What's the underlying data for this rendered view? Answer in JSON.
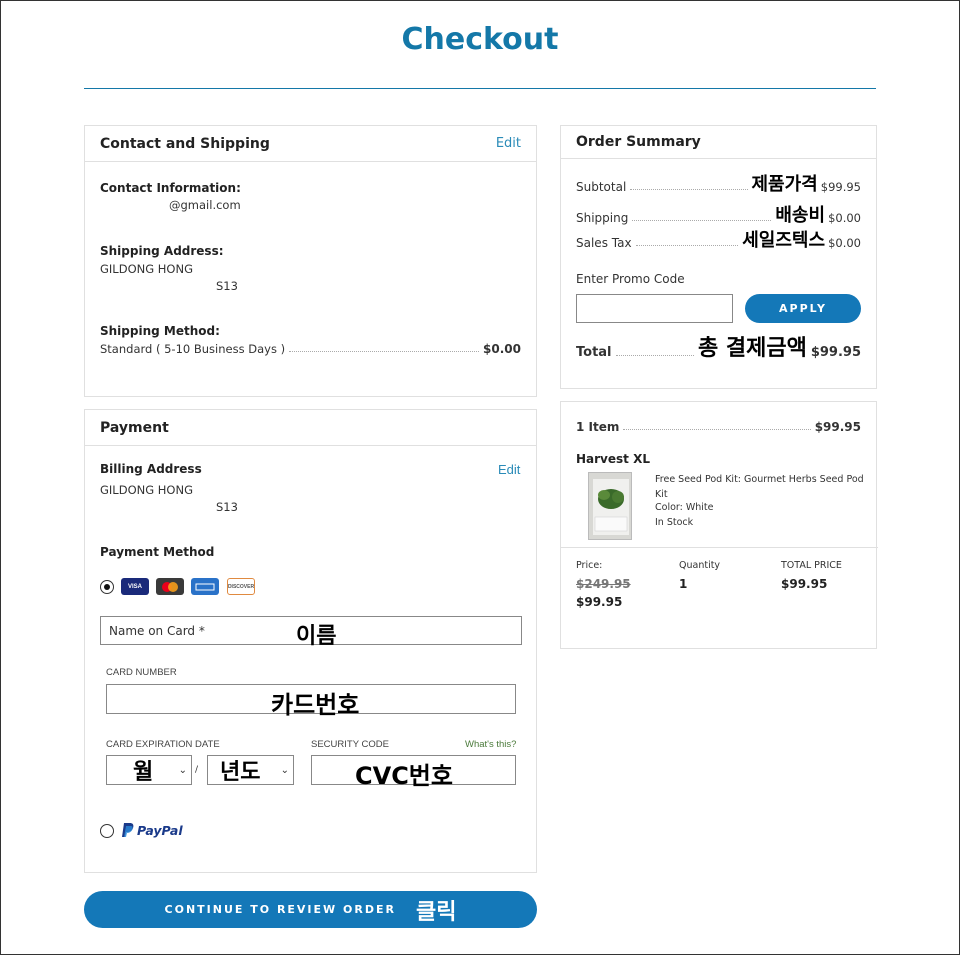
{
  "page": {
    "title": "Checkout"
  },
  "contact": {
    "header": "Contact and Shipping",
    "edit_label": "Edit",
    "contact_label": "Contact Information:",
    "email": "@gmail.com",
    "shipping_label": "Shipping Address:",
    "name": "GILDONG HONG",
    "address_line": "S13",
    "method_label": "Shipping Method:",
    "method_value": "Standard ( 5-10 Business Days )",
    "method_price": "$0.00"
  },
  "payment": {
    "header": "Payment",
    "billing_label": "Billing Address",
    "edit_label": "Edit",
    "name": "GILDONG HONG",
    "address_line": "S13",
    "method_label": "Payment Method",
    "card_brands": [
      "VISA",
      "MC",
      "AMEX",
      "DISCOVER"
    ],
    "name_on_card_label": "Name on Card *",
    "name_on_card_annotation": "이름",
    "card_number_label": "CARD NUMBER",
    "card_number_annotation": "카드번호",
    "expiration_label": "CARD EXPIRATION DATE",
    "month_annotation": "월",
    "year_annotation": "년도",
    "separator": "/",
    "security_label": "SECURITY CODE",
    "whats_this": "What's this?",
    "cvc_annotation": "CVC번호",
    "paypal_label": "PayPal"
  },
  "continue_button": {
    "label": "CONTINUE TO REVIEW ORDER",
    "annotation": "클릭"
  },
  "summary": {
    "header": "Order Summary",
    "subtotal_label": "Subtotal",
    "subtotal_annotation": "제품가격",
    "subtotal_value": "$99.95",
    "shipping_label": "Shipping",
    "shipping_annotation": "배송비",
    "shipping_value": "$0.00",
    "tax_label": "Sales Tax",
    "tax_annotation": "세일즈텍스",
    "tax_value": "$0.00",
    "promo_label": "Enter Promo Code",
    "promo_value": "",
    "apply_label": "APPLY",
    "total_label": "Total",
    "total_annotation": "총 결제금액",
    "total_value": "$99.95"
  },
  "item": {
    "count_label": "1 Item",
    "count_total": "$99.95",
    "product_name": "Harvest XL",
    "description": "Free Seed Pod Kit: Gourmet Herbs Seed Pod Kit",
    "color": "Color: White",
    "stock": "In Stock",
    "price_label": "Price:",
    "price_original": "$249.95",
    "price_sale": "$99.95",
    "quantity_label": "Quantity",
    "quantity_value": "1",
    "total_price_label": "TOTAL PRICE",
    "total_price_value": "$99.95"
  },
  "colors": {
    "accent": "#1478b8",
    "title": "#1478a8",
    "link": "#2a8bb8",
    "whats_this": "#4a7a3a"
  }
}
